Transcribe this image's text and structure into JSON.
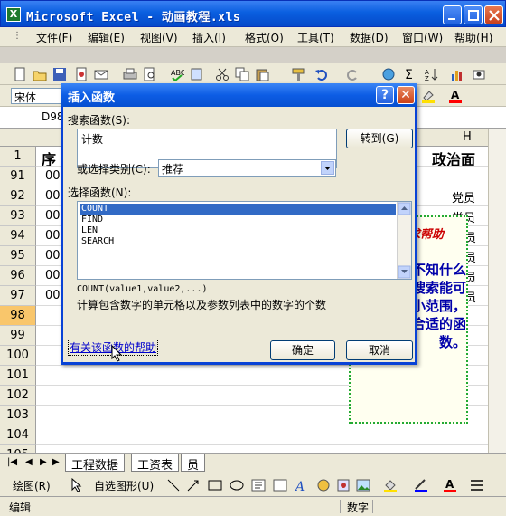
{
  "app": {
    "title": "Microsoft Excel - 动画教程.xls"
  },
  "menu": [
    "文件(F)",
    "编辑(E)",
    "视图(V)",
    "插入(I)",
    "格式(O)",
    "工具(T)",
    "数据(D)",
    "窗口(W)",
    "帮助(H)"
  ],
  "font": {
    "name": "宋体"
  },
  "namebox": "D98",
  "columns": {
    "h_header": "H"
  },
  "rows": [
    {
      "num": "1",
      "a": "序",
      "h": "政治面"
    },
    {
      "num": "91",
      "a": "00",
      "h": ""
    },
    {
      "num": "92",
      "a": "00",
      "h": "党员"
    },
    {
      "num": "93",
      "a": "00",
      "h": "党员"
    },
    {
      "num": "94",
      "a": "00",
      "h": "员"
    },
    {
      "num": "95",
      "a": "00",
      "h": "员"
    },
    {
      "num": "96",
      "a": "00",
      "h": "员"
    },
    {
      "num": "97",
      "a": "00",
      "h": "员"
    },
    {
      "num": "98",
      "a": "",
      "h": ""
    },
    {
      "num": "99",
      "a": "",
      "h": ""
    },
    {
      "num": "100",
      "a": "",
      "h": ""
    },
    {
      "num": "101",
      "a": "",
      "h": ""
    },
    {
      "num": "102",
      "a": "",
      "h": ""
    },
    {
      "num": "103",
      "a": "",
      "h": ""
    },
    {
      "num": "104",
      "a": "",
      "h": ""
    },
    {
      "num": "105",
      "a": "",
      "h": ""
    }
  ],
  "sheet_tabs": [
    "工程数据",
    "工资表",
    "员"
  ],
  "status": {
    "mode": "编辑",
    "numlock": "数字"
  },
  "draw_toolbar": {
    "draw_label": "绘图(R)",
    "autoshape_label": "自选图形(U)"
  },
  "balloon": {
    "title": "求帮助",
    "body": "处理数常不知什么函适。了搜索能可以帮你缩小范围，挑选出合适的函数。"
  },
  "dialog": {
    "title": "插入函数",
    "search_label": "搜索函数(S):",
    "search_value": "计数",
    "go_button": "转到(G)",
    "category_label": "或选择类别(C):",
    "category_value": "推荐",
    "select_label": "选择函数(N):",
    "functions": [
      "COUNT",
      "FIND",
      "LEN",
      "SEARCH"
    ],
    "selected_index": 0,
    "syntax": "COUNT(value1,value2,...)",
    "description": "计算包含数字的单元格以及参数列表中的数字的个数",
    "help_link": "有关该函数的帮助",
    "ok_button": "确定",
    "cancel_button": "取消"
  }
}
